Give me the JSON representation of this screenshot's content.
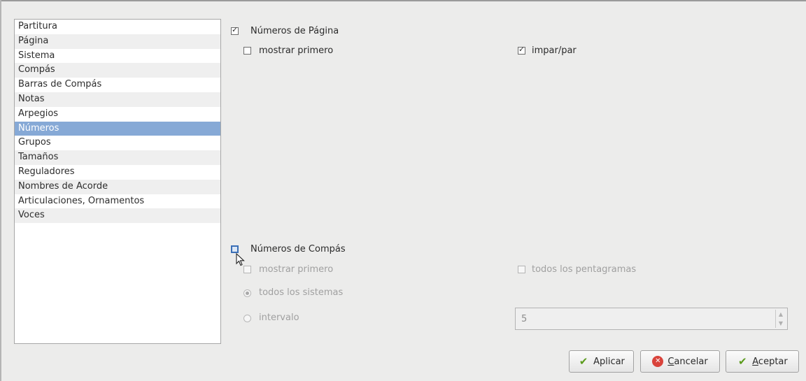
{
  "categories": [
    {
      "label": "Partitura"
    },
    {
      "label": "Página"
    },
    {
      "label": "Sistema"
    },
    {
      "label": "Compás"
    },
    {
      "label": "Barras de Compás"
    },
    {
      "label": "Notas"
    },
    {
      "label": "Arpegios"
    },
    {
      "label": "Números",
      "selected": true
    },
    {
      "label": "Grupos"
    },
    {
      "label": "Tamaños"
    },
    {
      "label": "Reguladores"
    },
    {
      "label": "Nombres de Acorde"
    },
    {
      "label": "Articulaciones, Ornamentos"
    },
    {
      "label": "Voces"
    }
  ],
  "page_numbers": {
    "label": "Números de Página",
    "checked": true,
    "show_first": {
      "label": "mostrar primero",
      "checked": false
    },
    "odd_even": {
      "label": "impar/par",
      "checked": true
    }
  },
  "measure_numbers": {
    "label": "Números de Compás",
    "checked": false,
    "show_first": {
      "label": "mostrar primero",
      "checked": false
    },
    "all_staves": {
      "label": "todos los pentagramas",
      "checked": false
    },
    "all_systems": {
      "label": "todos los sistemas",
      "selected": true
    },
    "interval": {
      "label": "intervalo",
      "selected": false,
      "value": "5"
    }
  },
  "buttons": {
    "apply": {
      "first": "",
      "underlined": "",
      "rest": "Aplicar"
    },
    "cancel": {
      "first": "",
      "underlined": "C",
      "rest": "ancelar"
    },
    "ok": {
      "first": "",
      "underlined": "A",
      "rest": "ceptar"
    }
  }
}
